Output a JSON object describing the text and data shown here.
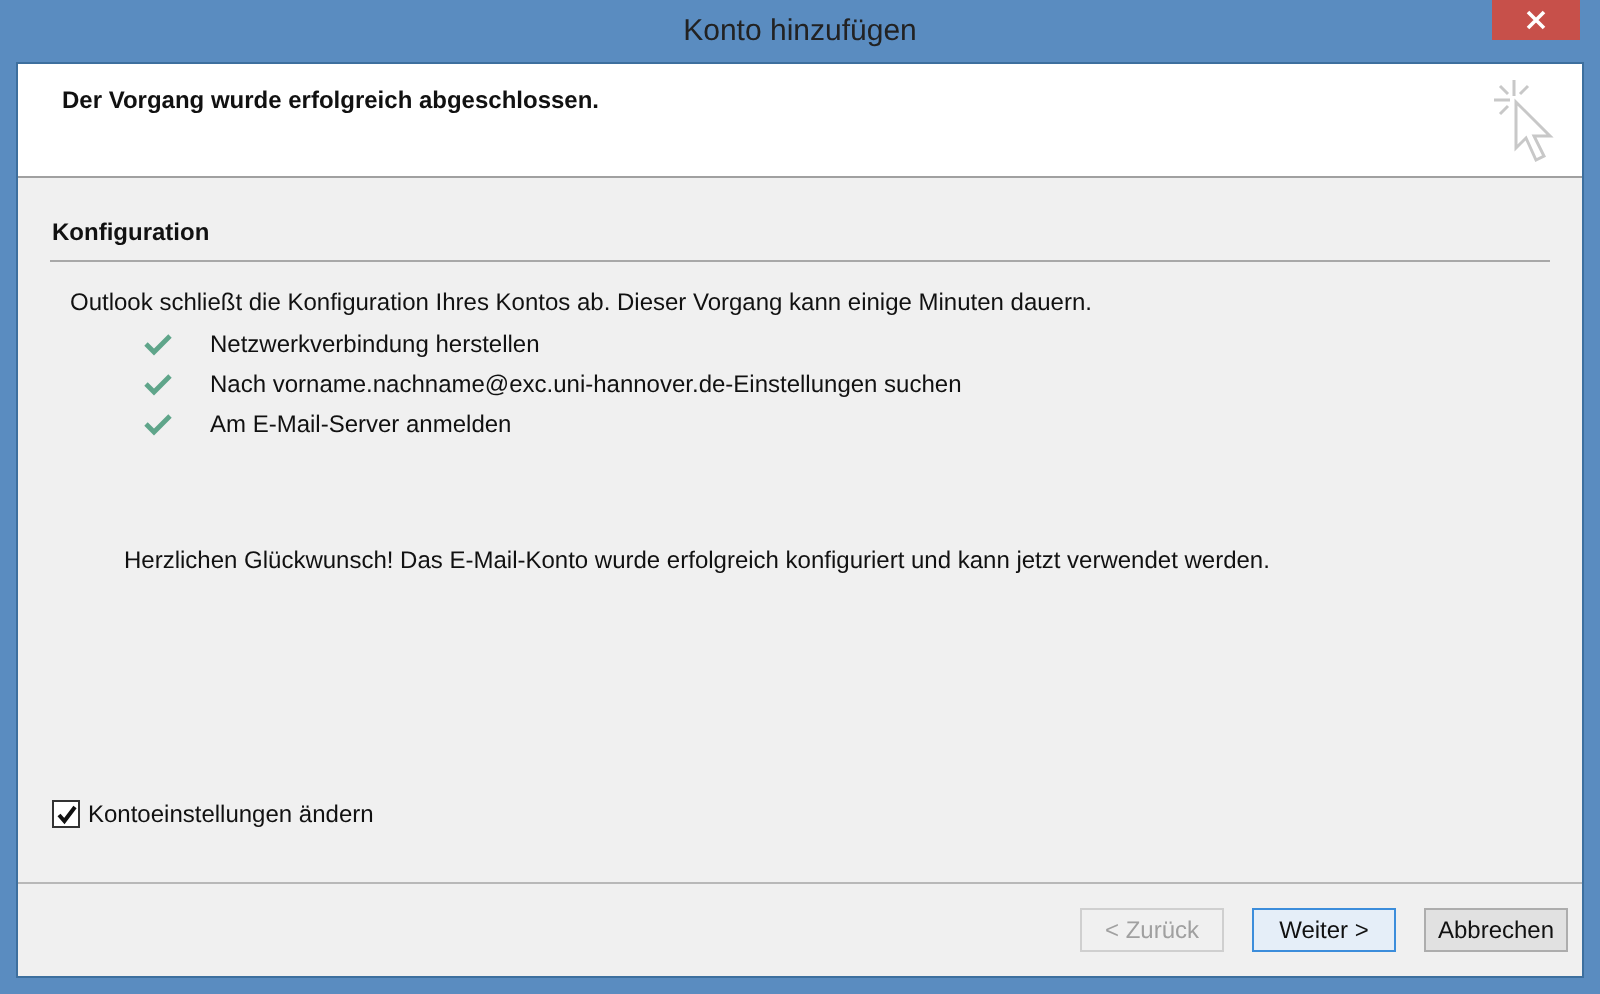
{
  "window": {
    "title": "Konto hinzufügen"
  },
  "header": {
    "message": "Der Vorgang wurde erfolgreich abgeschlossen."
  },
  "section": {
    "title": "Konfiguration",
    "intro": "Outlook schließt die Konfiguration Ihres Kontos ab. Dieser Vorgang kann einige Minuten dauern.",
    "steps": [
      {
        "label": "Netzwerkverbindung herstellen",
        "done": true
      },
      {
        "label": "Nach vorname.nachname@exc.uni-hannover.de-Einstellungen suchen",
        "done": true
      },
      {
        "label": "Am E-Mail-Server anmelden",
        "done": true
      }
    ],
    "result": "Herzlichen Glückwunsch! Das E-Mail-Konto wurde erfolgreich konfiguriert und kann jetzt verwendet werden."
  },
  "option": {
    "label": "Kontoeinstellungen ändern",
    "checked": true
  },
  "buttons": [
    {
      "label": "< Zurück",
      "disabled": true,
      "default": false
    },
    {
      "label": "Weiter >",
      "disabled": false,
      "default": true
    },
    {
      "label": "Abbrechen",
      "disabled": false,
      "default": false
    }
  ]
}
